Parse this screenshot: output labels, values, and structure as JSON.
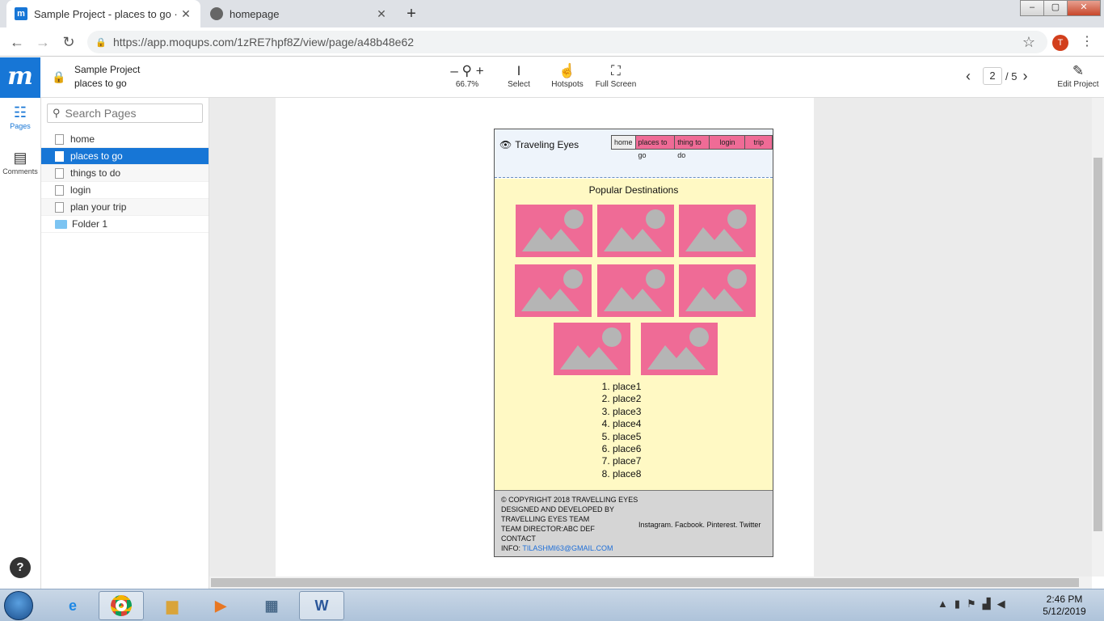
{
  "browser": {
    "tabs": [
      {
        "title": "Sample Project - places to go · M",
        "favicon": "moqups-icon"
      },
      {
        "title": "homepage",
        "favicon": "globe-icon"
      }
    ],
    "url": "https://app.moqups.com/1zRE7hpf8Z/view/page/a48b48e62",
    "profile_initial": "T"
  },
  "toolbar": {
    "project_name": "Sample Project",
    "page_name": "places to go",
    "zoom": "66.7%",
    "tools": [
      "Select",
      "Hotspots",
      "Full Screen"
    ],
    "current_page": "2",
    "total_pages": "/ 5",
    "edit_label": "Edit Project"
  },
  "rail": {
    "pages": "Pages",
    "comments": "Comments"
  },
  "pages_panel": {
    "search_placeholder": "Search Pages",
    "items": [
      "home",
      "places to go",
      "things to do",
      "login",
      "plan your trip",
      "Folder 1"
    ],
    "selected": "places to go"
  },
  "mockup": {
    "logo_text": "Traveling Eyes",
    "nav": [
      "home",
      "places to go",
      "thing to do",
      "login",
      "trip"
    ],
    "heading": "Popular Destinations",
    "places": [
      "place1",
      "place2",
      "place3",
      "place4",
      "place5",
      "place6",
      "place7",
      "place8"
    ],
    "footer": {
      "line1": "© COPYRIGHT 2018 TRAVELLING EYES",
      "line2": "DESIGNED AND DEVELOPED BY",
      "line3": "TRAVELLING EYES TEAM",
      "line4": "TEAM DIRECTOR:ABC DEF",
      "line5": "CONTACT",
      "info_label": "INFO: ",
      "email": "TILASHMI63@GMAIL.COM",
      "social": "Instagram. Facbook. Pinterest. Twitter"
    },
    "colors": {
      "nav_pink": "#ef6b96",
      "body_yellow": "#fff9c4",
      "footer_grey": "#d5d5d5"
    }
  },
  "taskbar": {
    "time": "2:46 PM",
    "date": "5/12/2019"
  }
}
